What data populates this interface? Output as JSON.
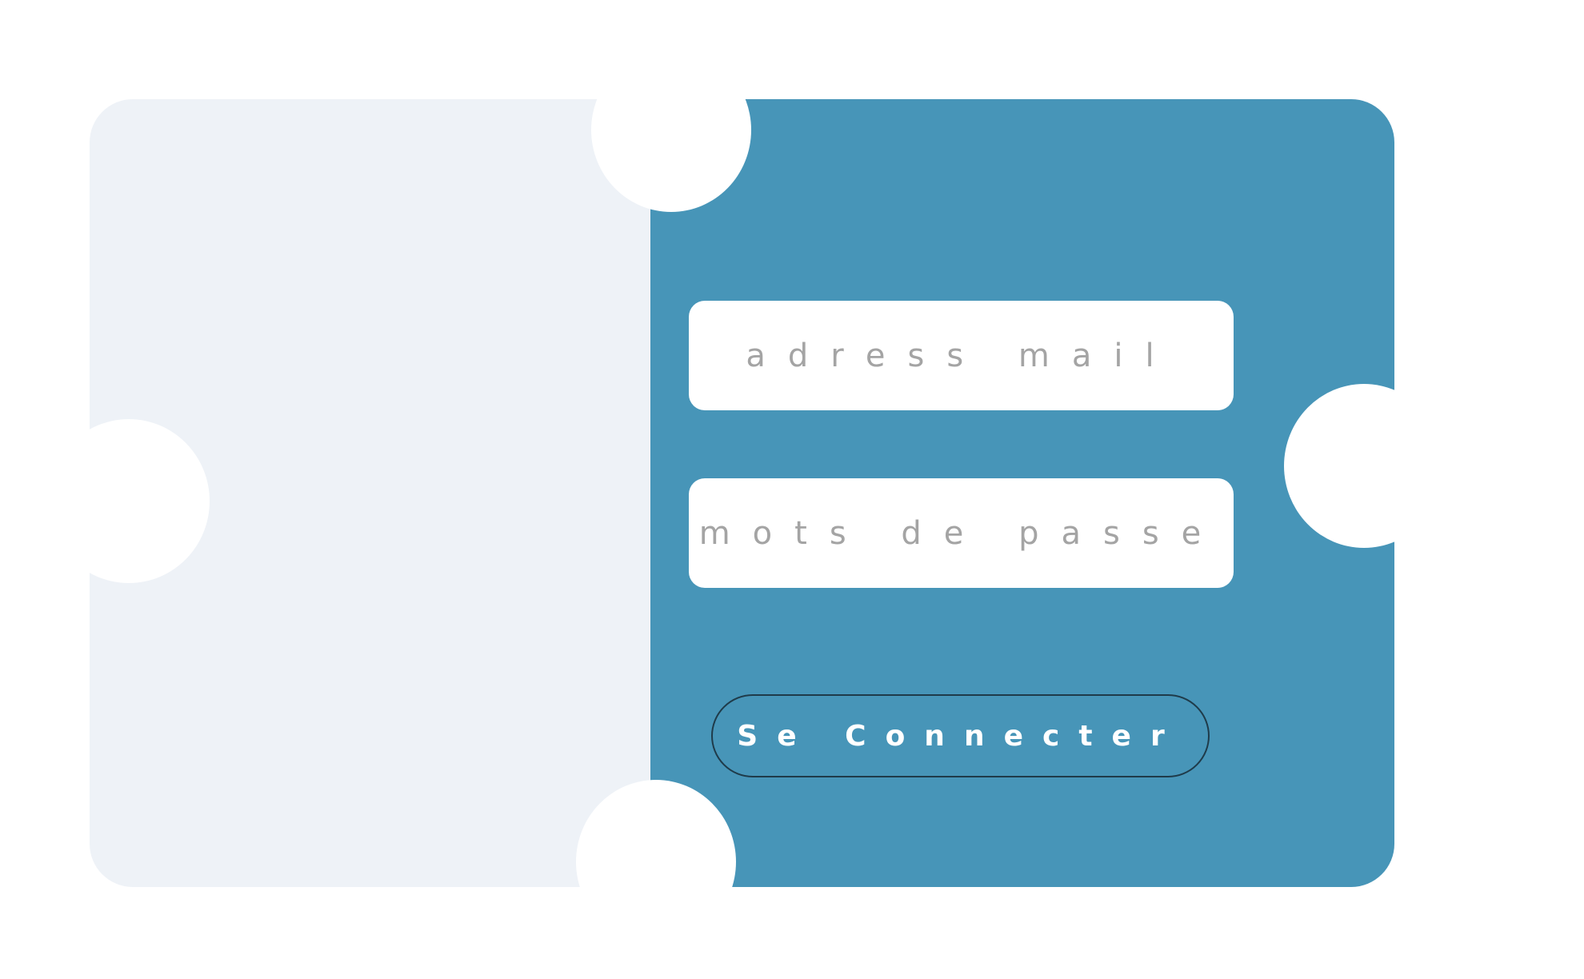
{
  "form": {
    "email_placeholder": "adress mail",
    "password_placeholder": "mots de passe",
    "submit_label": "Se Connecter"
  },
  "colors": {
    "left_panel": "#eef2f7",
    "right_panel": "#4795b8",
    "field_background": "#ffffff",
    "placeholder_text": "#a4a4a4",
    "button_text": "#ffffff"
  }
}
